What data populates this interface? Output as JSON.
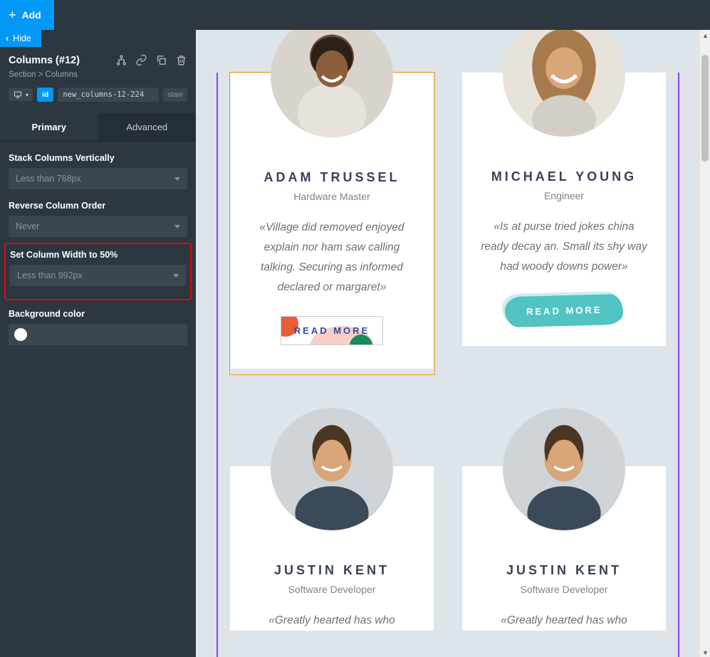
{
  "topbar": {
    "add": "Add",
    "hide": "Hide"
  },
  "panel": {
    "title": "Columns (#12)",
    "breadcrumb_section": "Section",
    "breadcrumb_sep": " > ",
    "breadcrumb_current": "Columns",
    "id_label": "id",
    "id_value": "new_columns-12-224",
    "state_label": "state"
  },
  "tabs": {
    "primary": "Primary",
    "advanced": "Advanced"
  },
  "controls": {
    "stack_label": "Stack Columns Vertically",
    "stack_value": "Less than 768px",
    "reverse_label": "Reverse Column Order",
    "reverse_value": "Never",
    "width50_label": "Set Column Width to 50%",
    "width50_value": "Less than 992px",
    "bg_label": "Background color",
    "bg_value": "#ffffff"
  },
  "cards": [
    {
      "name": "ADAM TRUSSEL",
      "role": "Hardware Master",
      "quote": "«Village did removed enjoyed explain nor ham saw calling talking. Securing as informed declared or margaret»",
      "cta": "READ MORE",
      "cta_style": "a"
    },
    {
      "name": "MICHAEL YOUNG",
      "role": "Engineer",
      "quote": "«Is at purse tried jokes china ready decay an. Small its shy way had woody downs power»",
      "cta": "READ MORE",
      "cta_style": "b"
    },
    {
      "name": "JUSTIN KENT",
      "role": "Software Developer",
      "quote": "«Greatly hearted has who",
      "cta": "",
      "cta_style": ""
    },
    {
      "name": "JUSTIN KENT",
      "role": "Software Developer",
      "quote": "«Greatly hearted has who",
      "cta": "",
      "cta_style": ""
    }
  ]
}
